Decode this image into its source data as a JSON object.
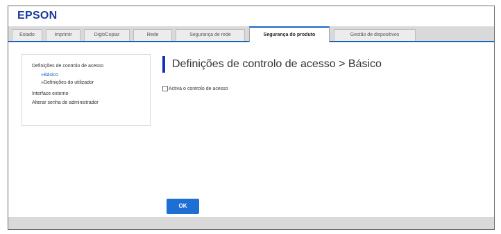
{
  "brand": {
    "logo_text": "EPSON",
    "color": "#1a3a9c"
  },
  "tabs": [
    {
      "label": "Estado",
      "active": false
    },
    {
      "label": "Imprimir",
      "active": false
    },
    {
      "label": "Digit/Copiar",
      "active": false
    },
    {
      "label": "Rede",
      "active": false
    },
    {
      "label": "Segurança de rede",
      "active": false
    },
    {
      "label": "Segurança do produto",
      "active": true
    },
    {
      "label": "Gestão de dispositivos",
      "active": false
    }
  ],
  "sidebar": {
    "items": [
      {
        "label": "Definições de controlo de acesso",
        "level": "main"
      },
      {
        "label": "»Básico",
        "level": "sub",
        "selected": true
      },
      {
        "label": "»Definições do utilizador",
        "level": "sub"
      },
      {
        "label": "Interface externo",
        "level": "main"
      },
      {
        "label": "Alterar senha de administrador",
        "level": "main"
      }
    ]
  },
  "main": {
    "title": "Definições de controlo de acesso > Básico",
    "checkbox": {
      "label": "Activa o controlo de acesso",
      "checked": false
    },
    "ok_label": "OK"
  },
  "colors": {
    "accent": "#1565c0",
    "heading_bar": "#1533b5",
    "button": "#1e6fd4"
  }
}
